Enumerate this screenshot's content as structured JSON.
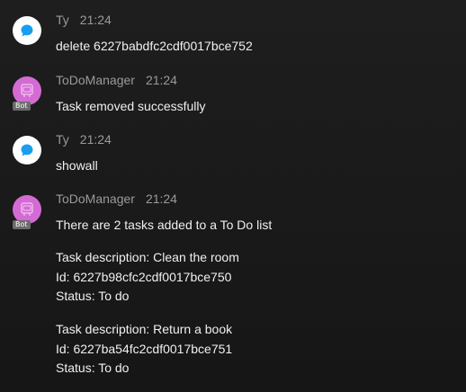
{
  "messages": [
    {
      "sender": "Ty",
      "time": "21:24",
      "avatar_icon": "chat-bubble-icon",
      "lines": [
        "delete 6227babdfc2cdf0017bce752"
      ]
    },
    {
      "sender": "ToDoManager",
      "time": "21:24",
      "avatar_icon": "bot-icon",
      "bot_tag": "Bot",
      "lines": [
        "Task removed successfully"
      ]
    },
    {
      "sender": "Ty",
      "time": "21:24",
      "avatar_icon": "chat-bubble-icon",
      "lines": [
        "showall"
      ]
    },
    {
      "sender": "ToDoManager",
      "time": "21:24",
      "avatar_icon": "bot-icon",
      "bot_tag": "Bot",
      "lines": [
        "There are 2 tasks added to a To Do list",
        "Task description: Clean the room",
        "Id: 6227b98cfc2cdf0017bce750",
        "Status: To do",
        "Task description: Return a book",
        "Id: 6227ba54fc2cdf0017bce751",
        "Status: To do"
      ]
    }
  ],
  "colors": {
    "user_avatar_bg": "#ffffff",
    "user_bubble": "#1b9ef0",
    "bot_avatar_bg": "#d46bd4",
    "meta_text": "#9a9a9a",
    "body_text": "#f0f0f0"
  }
}
